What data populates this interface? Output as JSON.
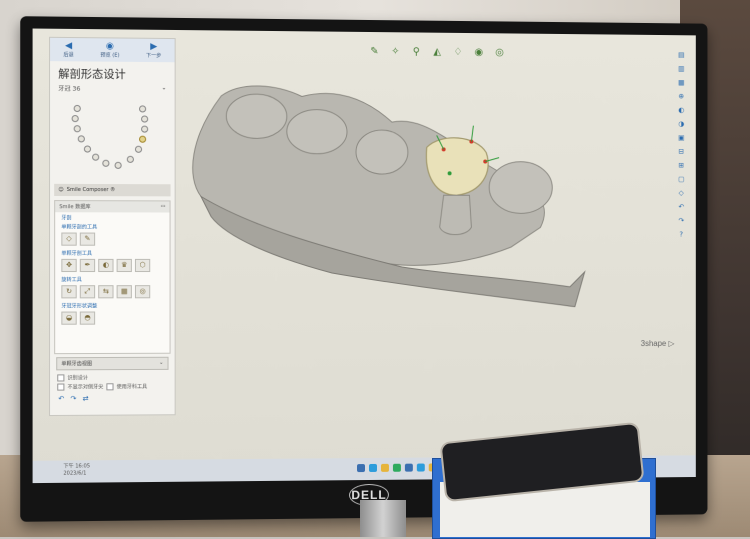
{
  "software": {
    "panel_title": "解剖形态设计",
    "tooth_label": "牙冠 36",
    "nav": [
      {
        "label": "后退",
        "icon": "arrow-left-icon"
      },
      {
        "label": "预览 (E)",
        "icon": "eye-icon"
      },
      {
        "label": "下一步",
        "icon": "arrow-right-icon"
      }
    ],
    "smile_composer": "Smile Composer ®",
    "library_header": "Smile 数据库",
    "tool_groups": [
      "牙剖",
      "单颗牙剖的工具",
      "单颗牙剖工具",
      "旋转工具",
      "牙冠牙形状调整"
    ],
    "mode_label": "单颗牙齿视图",
    "check_labels": [
      "识别设计",
      "不显示对侧牙尖",
      "使用牙科工具"
    ],
    "brand": "3shape ▷"
  },
  "monitor_brand": "DELL",
  "taskbar_text": [
    "下午 16:05",
    "2023/6/1"
  ]
}
